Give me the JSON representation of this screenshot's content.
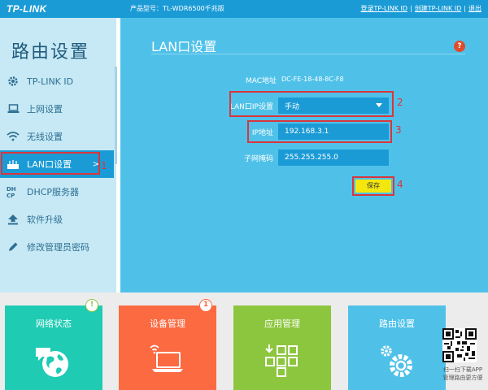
{
  "header": {
    "logo": "TP-LINK",
    "model": "产品型号：TL-WDR6500千兆版",
    "login_link": "登录TP-LINK ID",
    "create_link": "创建TP-LINK ID",
    "exit_link": "退出",
    "separator": "|"
  },
  "sidebar": {
    "title": "路由设置",
    "items": [
      {
        "label": "TP-LINK ID",
        "icon": "gear-icon"
      },
      {
        "label": "上网设置",
        "icon": "laptop-icon"
      },
      {
        "label": "无线设置",
        "icon": "wifi-icon"
      },
      {
        "label": "LAN口设置",
        "icon": "router-icon",
        "arrow": ">"
      },
      {
        "label": "DHCP服务器",
        "icon": "dhcp-icon"
      },
      {
        "label": "软件升级",
        "icon": "upgrade-icon"
      },
      {
        "label": "修改管理员密码",
        "icon": "pencil-icon"
      }
    ],
    "annotation": "1"
  },
  "main": {
    "title": "LAN口设置",
    "help": "?",
    "mac_label": "MAC地址",
    "mac_value": "DC-FE-18-48-8C-F8",
    "lanip_label": "LAN口IP设置",
    "lanip_value": "手动",
    "ip_label": "IP地址",
    "ip_value": "192.168.3.1",
    "mask_label": "子网掩码",
    "mask_value": "255.255.255.0",
    "save_label": "保存",
    "annotations": [
      "2",
      "3",
      "4"
    ]
  },
  "bottom": {
    "tiles": [
      {
        "label": "网络状态",
        "badge": "!"
      },
      {
        "label": "设备管理",
        "badge": "1"
      },
      {
        "label": "应用管理"
      },
      {
        "label": "路由设置"
      }
    ],
    "qr_text_1": "扫一扫下载APP",
    "qr_text_2": "管理路由更方便"
  },
  "colors": {
    "topbar": "#1b9bd6",
    "sidebar": "#c6e9f5",
    "main": "#4fc1e9",
    "tile_network": "#1fcbb3",
    "tile_device": "#fb6a41",
    "tile_apps": "#8cc63e",
    "tile_router": "#4fc1e9",
    "annotation": "#d9363b",
    "save": "#f4e70d"
  }
}
